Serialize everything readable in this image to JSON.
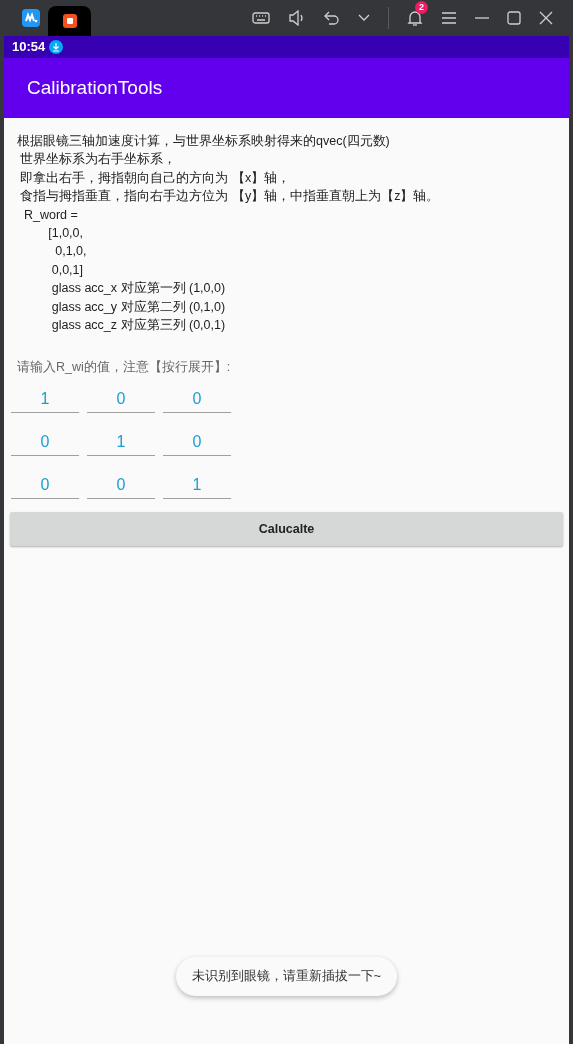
{
  "host_bar": {
    "notification_count": "2"
  },
  "status_bar": {
    "time": "10:54"
  },
  "app_bar": {
    "title": "CalibrationTools"
  },
  "description": [
    "根据眼镜三轴加速度计算，与世界坐标系映射得来的qvec(四元数)",
    " 世界坐标系为右手坐标系，",
    " 即拿出右手，拇指朝向自己的方向为 【x】轴，",
    " 食指与拇指垂直，指向右手边方位为 【y】轴，中指垂直朝上为【z】轴。",
    "  R_word =",
    "         [1,0,0,",
    "           0,1,0,",
    "          0,0,1]",
    "          glass acc_x 对应第一列 (1,0,0)",
    "          glass acc_y 对应第二列 (0,1,0)",
    "          glass acc_z 对应第三列 (0,0,1)"
  ],
  "matrix_prompt": "请输入R_wi的值，注意【按行展开】:",
  "matrix": [
    [
      "1",
      "0",
      "0"
    ],
    [
      "0",
      "1",
      "0"
    ],
    [
      "0",
      "0",
      "1"
    ]
  ],
  "calculate_button": "Calucalte",
  "toast": "未识别到眼镜，请重新插拔一下~"
}
